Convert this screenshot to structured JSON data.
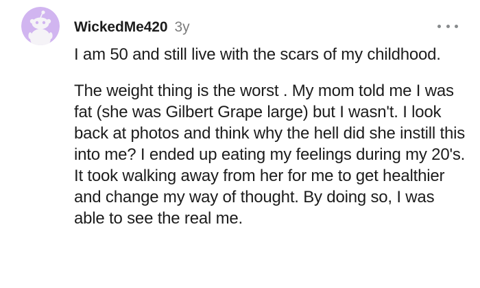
{
  "comment": {
    "avatar_icon": "snoo-avatar-icon",
    "avatar_bg": "#d1b5f0",
    "username": "WickedMe420",
    "age": "3y",
    "more_icon": "more-options-icon",
    "paragraphs": [
      "I am 50 and still live with the scars of my childhood.",
      "The weight thing is the worst . My mom told me I was fat (she was Gilbert Grape large) but I wasn't. I look back at photos and think why the hell did she instill this into me? I ended up eating my feelings during my 20's. It took walking away from her for me to get healthier and change my way of thought. By doing so, I was able to see the real me."
    ]
  }
}
